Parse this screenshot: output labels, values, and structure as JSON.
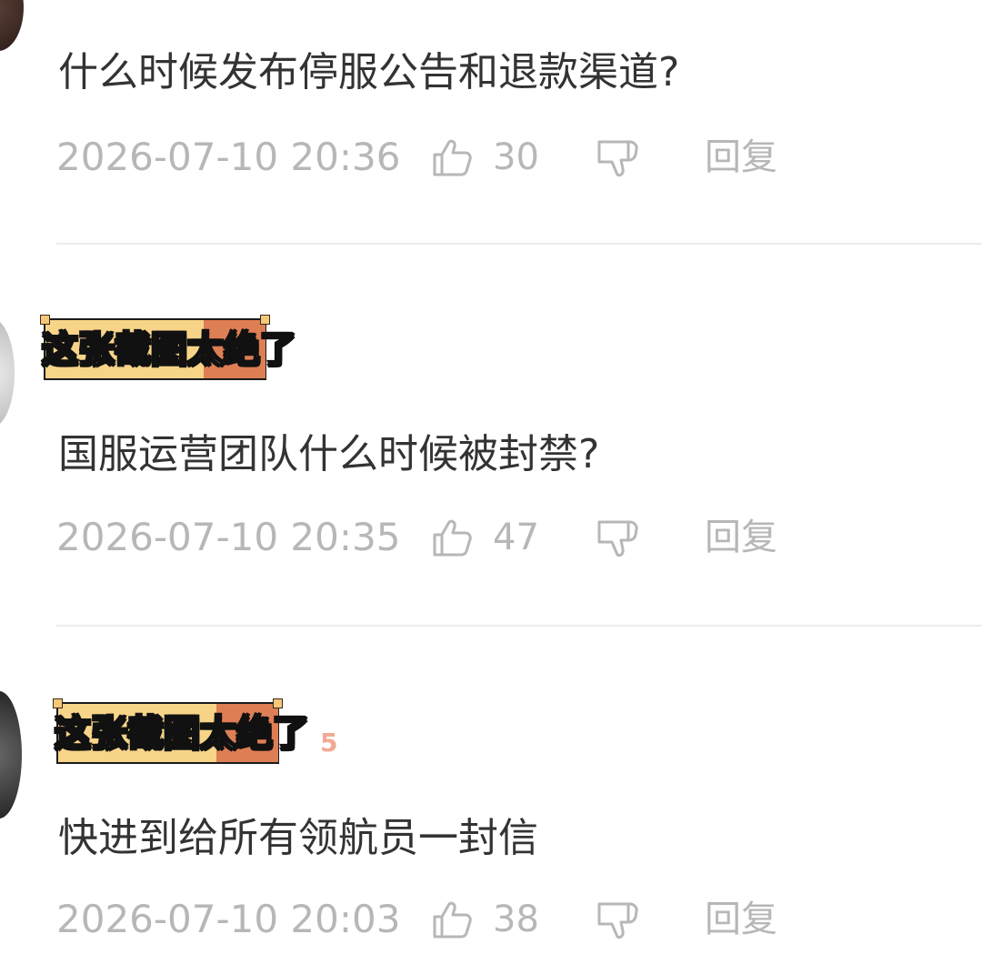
{
  "comments": [
    {
      "username": "",
      "text": "什么时候发布停服公告和退款渠道?",
      "time": "2026-07-10 20:36",
      "likes": "30",
      "reply_label": "回复"
    },
    {
      "username": "这张截图太绝了",
      "text": "国服运营团队什么时候被封禁?",
      "time": "2026-07-10 20:35",
      "likes": "47",
      "reply_label": "回复"
    },
    {
      "username": "这张截图太绝了",
      "text": "快进到给所有领航员一封信",
      "time": "2026-07-10 20:03",
      "likes": "38",
      "reply_label": "回复"
    }
  ],
  "colors": {
    "text": "#333333",
    "meta": "#b7b7b7",
    "divider": "#ececec",
    "sticker_yellow": "#f7d488",
    "sticker_orange": "#de7e55"
  },
  "icons": {
    "like": "thumbs-up-icon",
    "dislike": "thumbs-down-icon"
  }
}
